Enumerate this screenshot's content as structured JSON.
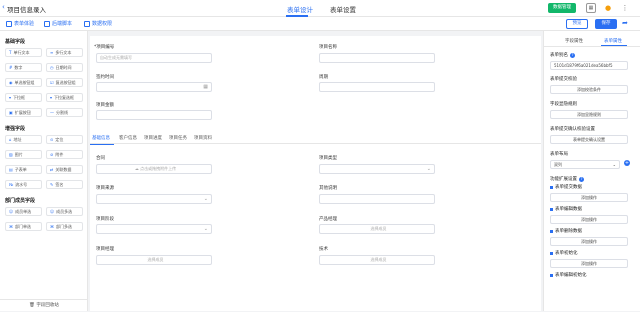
{
  "header": {
    "title": "项目信息录入",
    "tabs": [
      "表单设计",
      "表单设置"
    ],
    "manage_label": "数据管理"
  },
  "toolbar": {
    "items": [
      "表单体验",
      "后端脚本",
      "数据权限"
    ],
    "preview_label": "预览",
    "save_label": "保存"
  },
  "left": {
    "groups": [
      {
        "title": "基础字段",
        "fields": [
          "单行文本",
          "多行文本",
          "数字",
          "日期时间",
          "单选按钮组",
          "复选按钮组",
          "下拉框",
          "下拉复选框",
          "扩展按钮",
          "分割线"
        ]
      },
      {
        "title": "增强字段",
        "fields": [
          "地址",
          "定位",
          "图片",
          "附件",
          "子表单",
          "关联数据",
          "流水号",
          "签名"
        ]
      },
      {
        "title": "部门成员字段",
        "fields": [
          "成员单选",
          "成员多选",
          "部门单选",
          "部门多选"
        ]
      }
    ],
    "footer": "字段回收站"
  },
  "form": {
    "code_label": "*项目编号",
    "code_placeholder": "自动生成无需填写",
    "name_label": "项目名称",
    "sign_label": "签约时间",
    "period_label": "周期",
    "amount_label": "项目金额",
    "subtabs": [
      "基础信息",
      "客户信息",
      "项目进度",
      "项目任务",
      "项目资料"
    ],
    "contract_label": "合同",
    "upload_text": "点击或拖拽附件上传",
    "type_label": "项目类型",
    "source_label": "项目来源",
    "other_label": "其他说明",
    "stage_label": "项目阶段",
    "pm_label": "产品经理",
    "choose_member": "选择成员",
    "manager_label": "项目经理",
    "tech_label": "技术"
  },
  "right": {
    "tabs": [
      "字段属性",
      "表单属性"
    ],
    "form_name_label": "表单别名",
    "form_name_value": "5101d1879f6a021dea56bbf5",
    "submit_label": "表单提交校验",
    "add_condition": "添加校验条件",
    "hide_label": "字段显隐规则",
    "add_hide": "添加显隐规则",
    "confirm_label": "表单提交确认校验设置",
    "confirm_btn": "表单提交确认设置",
    "layout_label": "表单布局",
    "layout_value": "双列",
    "ext_label": "功能扩展设置",
    "ext_items": [
      "表单提交数据",
      "表单编辑数据",
      "表单删除数据",
      "表单初始化",
      "表单编辑初始化"
    ],
    "add_action": "添加操作"
  }
}
